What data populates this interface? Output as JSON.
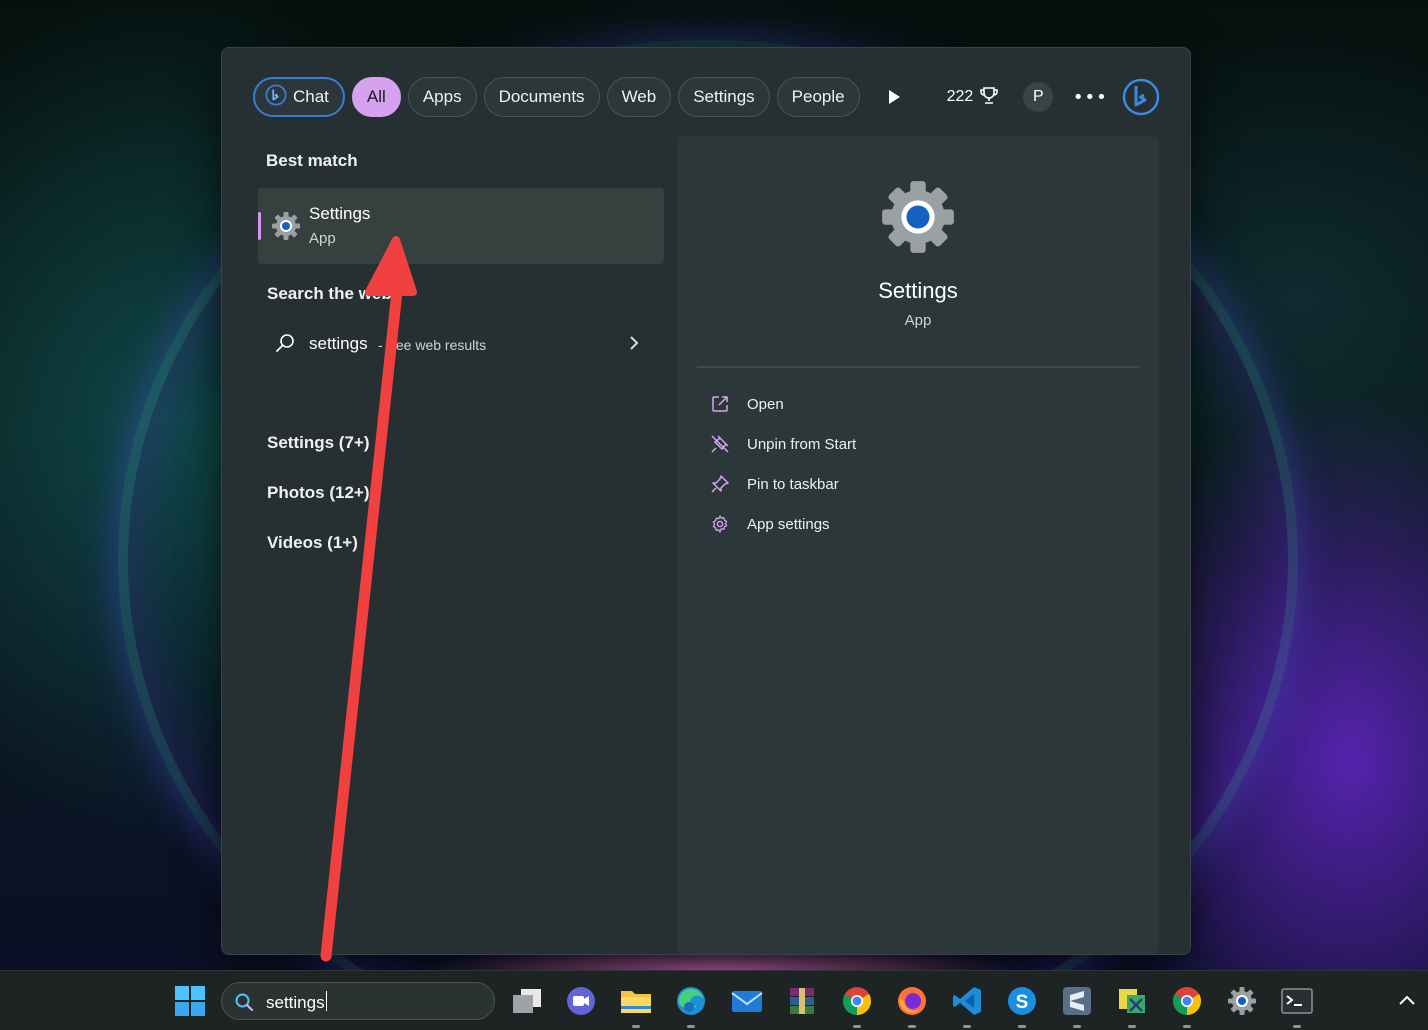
{
  "filters": {
    "chat": "Chat",
    "all": "All",
    "apps": "Apps",
    "documents": "Documents",
    "web": "Web",
    "settings": "Settings",
    "people": "People"
  },
  "rewards_points": "222",
  "profile_initial": "P",
  "best_match": {
    "title": "Best match",
    "name": "Settings",
    "type": "App"
  },
  "web_search": {
    "title": "Search the web",
    "query": "settings",
    "suffix": "- See web results"
  },
  "groups": [
    "Settings (7+)",
    "Photos (12+)",
    "Videos (1+)"
  ],
  "preview": {
    "name": "Settings",
    "type": "App",
    "actions": [
      "Open",
      "Unpin from Start",
      "Pin to taskbar",
      "App settings"
    ]
  },
  "taskbar": {
    "search_value": "settings",
    "apps": [
      "task-view",
      "teams-chat",
      "file-explorer",
      "edge",
      "mail",
      "winrar",
      "chrome",
      "firefox",
      "vscode",
      "skype",
      "sublime",
      "mixed-app",
      "chrome-2",
      "settings",
      "terminal"
    ]
  },
  "colors": {
    "accent_purple": "#d6a2f0",
    "bing_blue": "#3a7bd5",
    "annotation_red": "#f04040"
  }
}
